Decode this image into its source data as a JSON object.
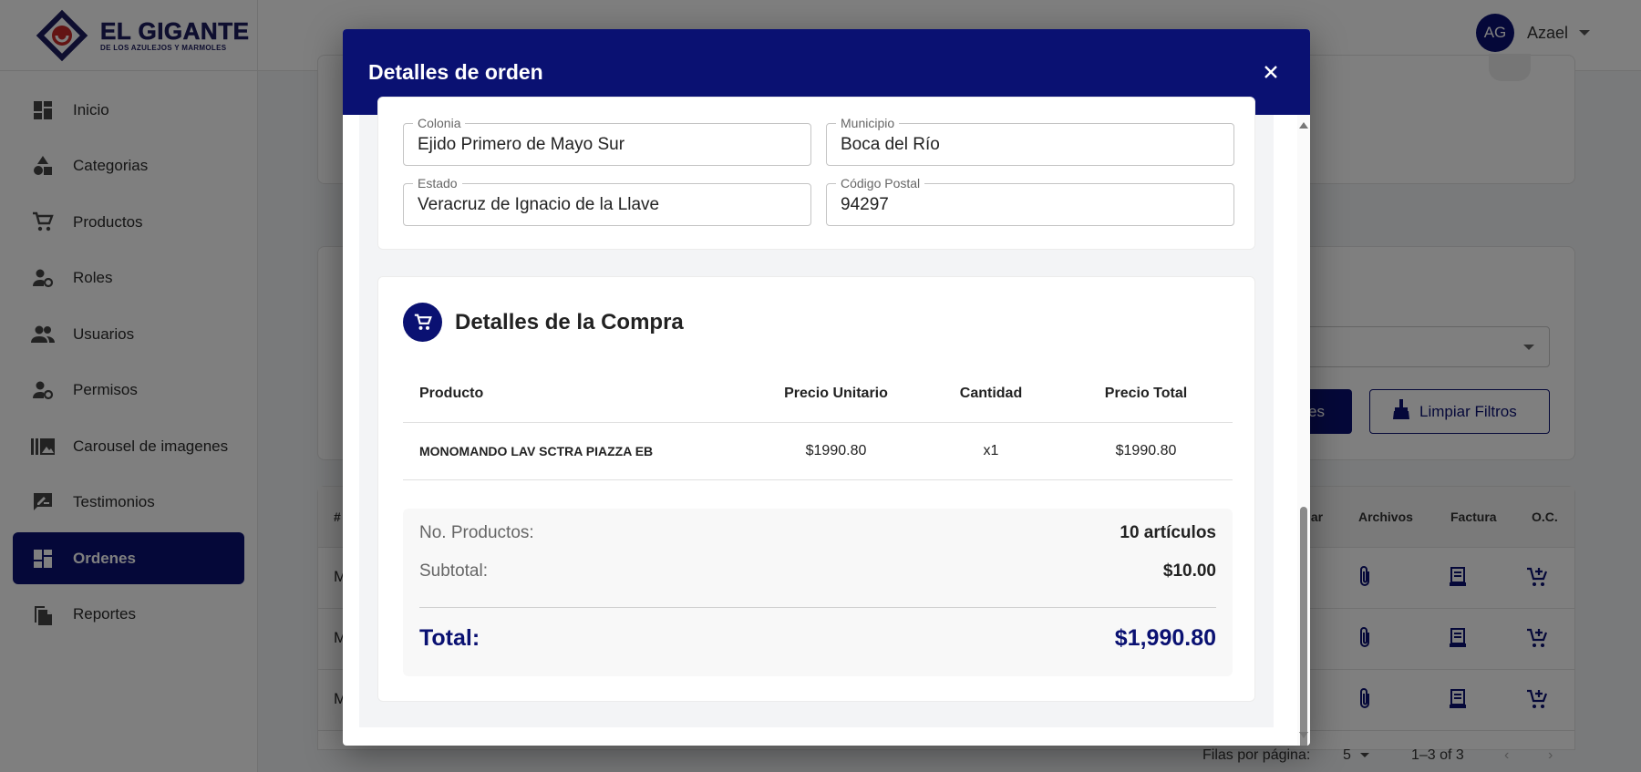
{
  "brand": {
    "name": "EL GIGANTE",
    "tagline": "DE LOS AZULEJOS Y MARMOLES"
  },
  "sidebar": {
    "items": [
      {
        "label": "Inicio",
        "icon": "dashboard-icon"
      },
      {
        "label": "Categorias",
        "icon": "category-icon"
      },
      {
        "label": "Productos",
        "icon": "cart-icon"
      },
      {
        "label": "Roles",
        "icon": "user-gear-icon"
      },
      {
        "label": "Usuarios",
        "icon": "users-icon"
      },
      {
        "label": "Permisos",
        "icon": "user-gear-icon"
      },
      {
        "label": "Carousel de imagenes",
        "icon": "gallery-icon"
      },
      {
        "label": "Testimonios",
        "icon": "review-icon"
      },
      {
        "label": "Ordenes",
        "icon": "dashboard-icon",
        "active": true
      },
      {
        "label": "Reportes",
        "icon": "files-icon"
      }
    ]
  },
  "user": {
    "initials": "AG",
    "name": "Azael"
  },
  "background": {
    "apply_button_partial": "es",
    "clear_filters_label": "Limpiar Filtros",
    "table_headers": {
      "hash": "#",
      "partial_col": "lar",
      "files": "Archivos",
      "invoice": "Factura",
      "po": "O.C."
    },
    "row_prefix": "M",
    "pagination": {
      "rows_label": "Filas por página:",
      "rows_value": "5",
      "range": "1–3 of 3"
    }
  },
  "modal": {
    "title": "Detalles de orden",
    "address": {
      "colonia": {
        "label": "Colonia",
        "value": "Ejido Primero de Mayo Sur"
      },
      "municipio": {
        "label": "Municipio",
        "value": "Boca del Río"
      },
      "estado": {
        "label": "Estado",
        "value": "Veracruz de Ignacio de la Llave"
      },
      "cp": {
        "label": "Código Postal",
        "value": "94297"
      }
    },
    "purchase": {
      "title": "Detalles de la Compra",
      "columns": [
        "Producto",
        "Precio Unitario",
        "Cantidad",
        "Precio Total"
      ],
      "rows": [
        {
          "product": "MONOMANDO LAV SCTRA PIAZZA EB",
          "unit_price": "$1990.80",
          "qty": "x1",
          "total": "$1990.80"
        }
      ],
      "summary": {
        "products_label": "No. Productos:",
        "products_value": "10 artículos",
        "subtotal_label": "Subtotal:",
        "subtotal_value": "$10.00",
        "total_label": "Total:",
        "total_value": "$1,990.80"
      }
    }
  },
  "colors": {
    "primary": "#0a1172",
    "overlay": "rgba(0,0,0,0.5)"
  }
}
